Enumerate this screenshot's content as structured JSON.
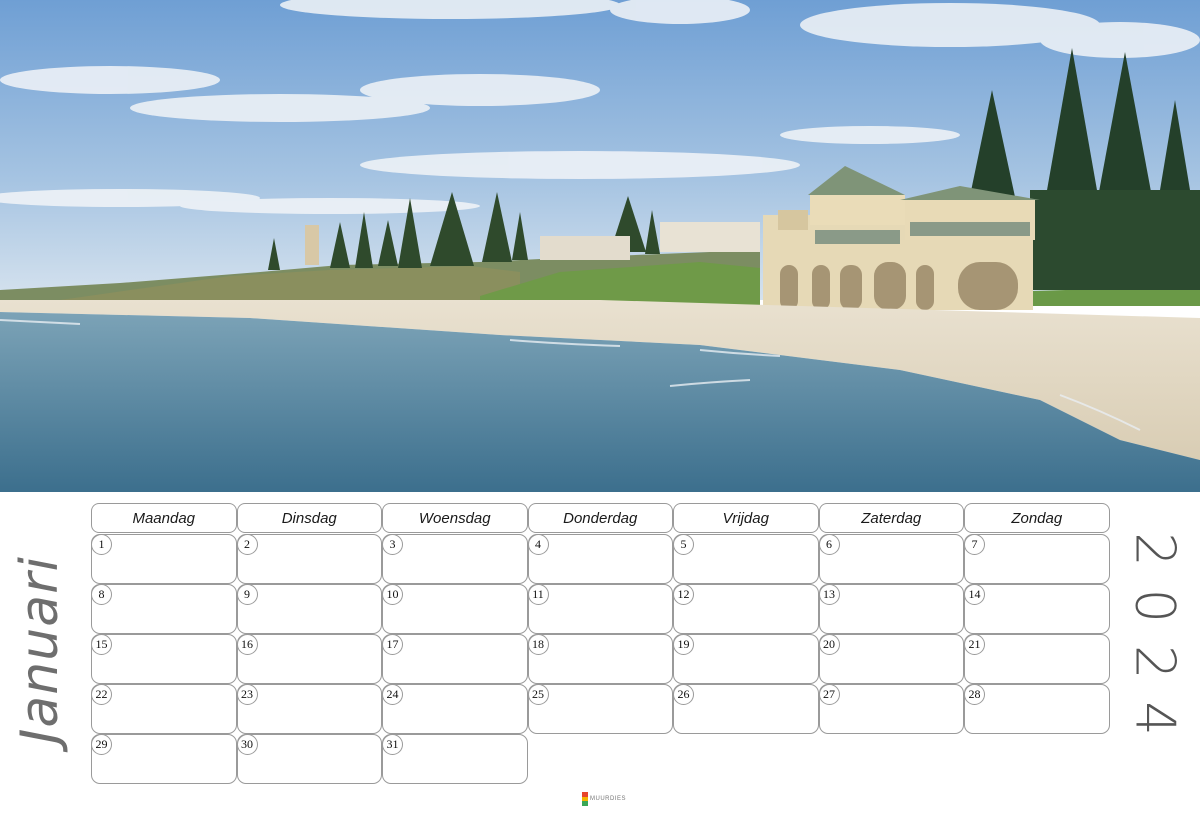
{
  "calendar": {
    "month": "Januari",
    "year": "2024",
    "weekdays": [
      "Maandag",
      "Dinsdag",
      "Woensdag",
      "Donderdag",
      "Vrijdag",
      "Zaterdag",
      "Zondag"
    ],
    "weeks": [
      [
        "1",
        "2",
        "3",
        "4",
        "5",
        "6",
        "7"
      ],
      [
        "8",
        "9",
        "10",
        "11",
        "12",
        "13",
        "14"
      ],
      [
        "15",
        "16",
        "17",
        "18",
        "19",
        "20",
        "21"
      ],
      [
        "22",
        "23",
        "24",
        "25",
        "26",
        "27",
        "28"
      ],
      [
        "29",
        "30",
        "31",
        "",
        "",
        "",
        ""
      ]
    ]
  },
  "branding": {
    "logo_text": "MUURDIES"
  },
  "colors": {
    "sky": "#8fb4dc",
    "sea": "#4f7f9a",
    "sand": "#e6dcc8",
    "grid_border": "#9a9a9a",
    "month_text": "#6e6e6e"
  }
}
